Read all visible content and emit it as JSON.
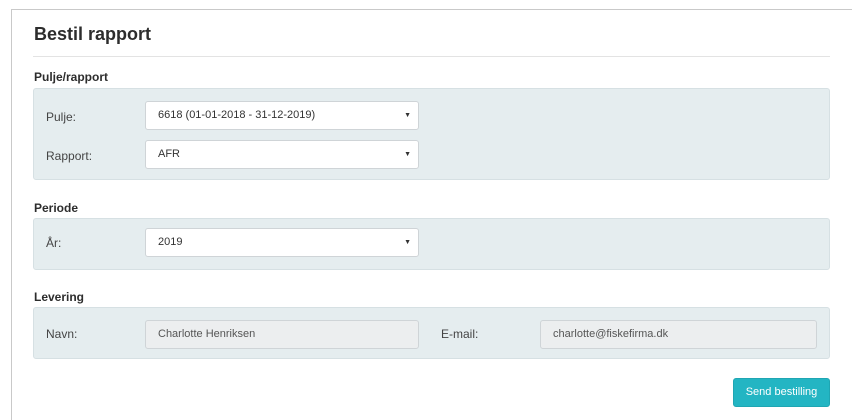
{
  "title": "Bestil rapport",
  "sections": {
    "pulje_rapport": {
      "label": "Pulje/rapport",
      "pulje": {
        "label": "Pulje:",
        "value": "6618 (01-01-2018 - 31-12-2019)"
      },
      "rapport": {
        "label": "Rapport:",
        "value": "AFR"
      }
    },
    "periode": {
      "label": "Periode",
      "aar": {
        "label": "År:",
        "value": "2019"
      }
    },
    "levering": {
      "label": "Levering",
      "navn": {
        "label": "Navn:",
        "value": "Charlotte Henriksen"
      },
      "email": {
        "label": "E-mail:",
        "value": "charlotte@fiskefirma.dk"
      }
    }
  },
  "caret": "▼",
  "submit_label": "Send bestilling",
  "colors": {
    "accent": "#23b5c3",
    "panel": "#e5edef",
    "readonly": "#eceeef"
  }
}
